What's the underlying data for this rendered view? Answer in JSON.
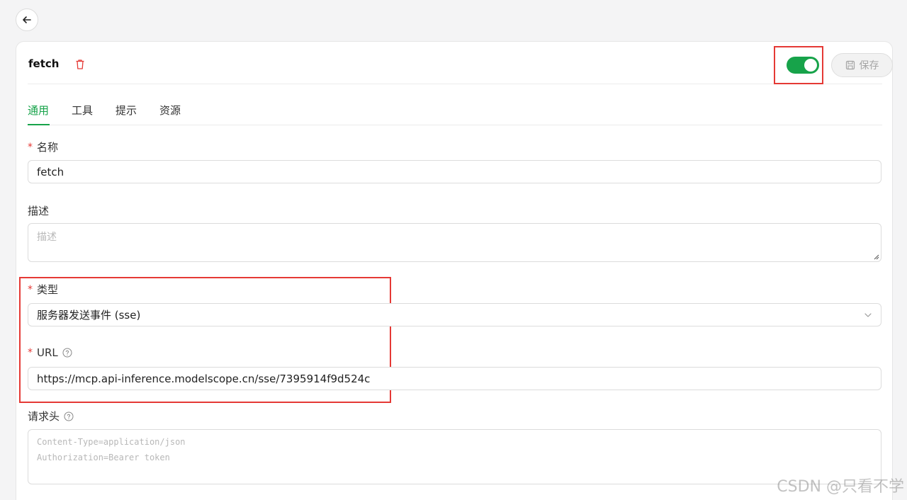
{
  "header": {
    "title": "fetch",
    "save_label": "保存",
    "enabled": true
  },
  "tabs": [
    {
      "label": "通用",
      "active": true
    },
    {
      "label": "工具",
      "active": false
    },
    {
      "label": "提示",
      "active": false
    },
    {
      "label": "资源",
      "active": false
    }
  ],
  "form": {
    "name": {
      "label": "名称",
      "required_mark": "*",
      "value": "fetch"
    },
    "description": {
      "label": "描述",
      "placeholder": "描述"
    },
    "type": {
      "label": "类型",
      "required_mark": "*",
      "value": "服务器发送事件 (sse)"
    },
    "url": {
      "label": "URL",
      "required_mark": "*",
      "value": "https://mcp.api-inference.modelscope.cn/sse/7395914f9d524c"
    },
    "headers": {
      "label": "请求头",
      "placeholder_lines": [
        "Content-Type=application/json",
        "Authorization=Bearer token"
      ]
    }
  },
  "watermark": "CSDN @只看不学",
  "colors": {
    "accent": "#17a34a",
    "highlight": "#e53935",
    "required": "#e53935"
  }
}
